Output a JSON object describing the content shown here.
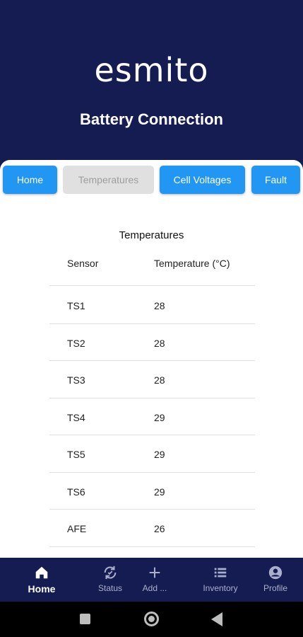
{
  "header": {
    "logo_text": "esmito",
    "title": "Battery Connection"
  },
  "tabs": [
    {
      "label": "Home",
      "state": "active"
    },
    {
      "label": "Temperatures",
      "state": "disabled"
    },
    {
      "label": "Cell Voltages",
      "state": "active"
    },
    {
      "label": "Fault",
      "state": "active"
    }
  ],
  "table": {
    "title": "Temperatures",
    "columns": [
      "Sensor",
      "Temperature (°C)"
    ],
    "rows": [
      {
        "sensor": "TS1",
        "temp": "28"
      },
      {
        "sensor": "TS2",
        "temp": "28"
      },
      {
        "sensor": "TS3",
        "temp": "28"
      },
      {
        "sensor": "TS4",
        "temp": "29"
      },
      {
        "sensor": "TS5",
        "temp": "29"
      },
      {
        "sensor": "TS6",
        "temp": "29"
      },
      {
        "sensor": "AFE",
        "temp": "26"
      }
    ]
  },
  "bottom_nav": [
    {
      "label": "Home",
      "icon": "home-icon",
      "active": true
    },
    {
      "label": "Status",
      "icon": "sync-icon",
      "active": false
    },
    {
      "label": "Add ...",
      "icon": "plus-icon",
      "active": false
    },
    {
      "label": "Inventory",
      "icon": "list-icon",
      "active": false
    },
    {
      "label": "Profile",
      "icon": "account-icon",
      "active": false
    }
  ],
  "colors": {
    "header_bg": "#151c52",
    "tab_blue": "#2196f3",
    "tab_disabled": "#e0e0e0",
    "logo_accent": "#38b6e8"
  }
}
